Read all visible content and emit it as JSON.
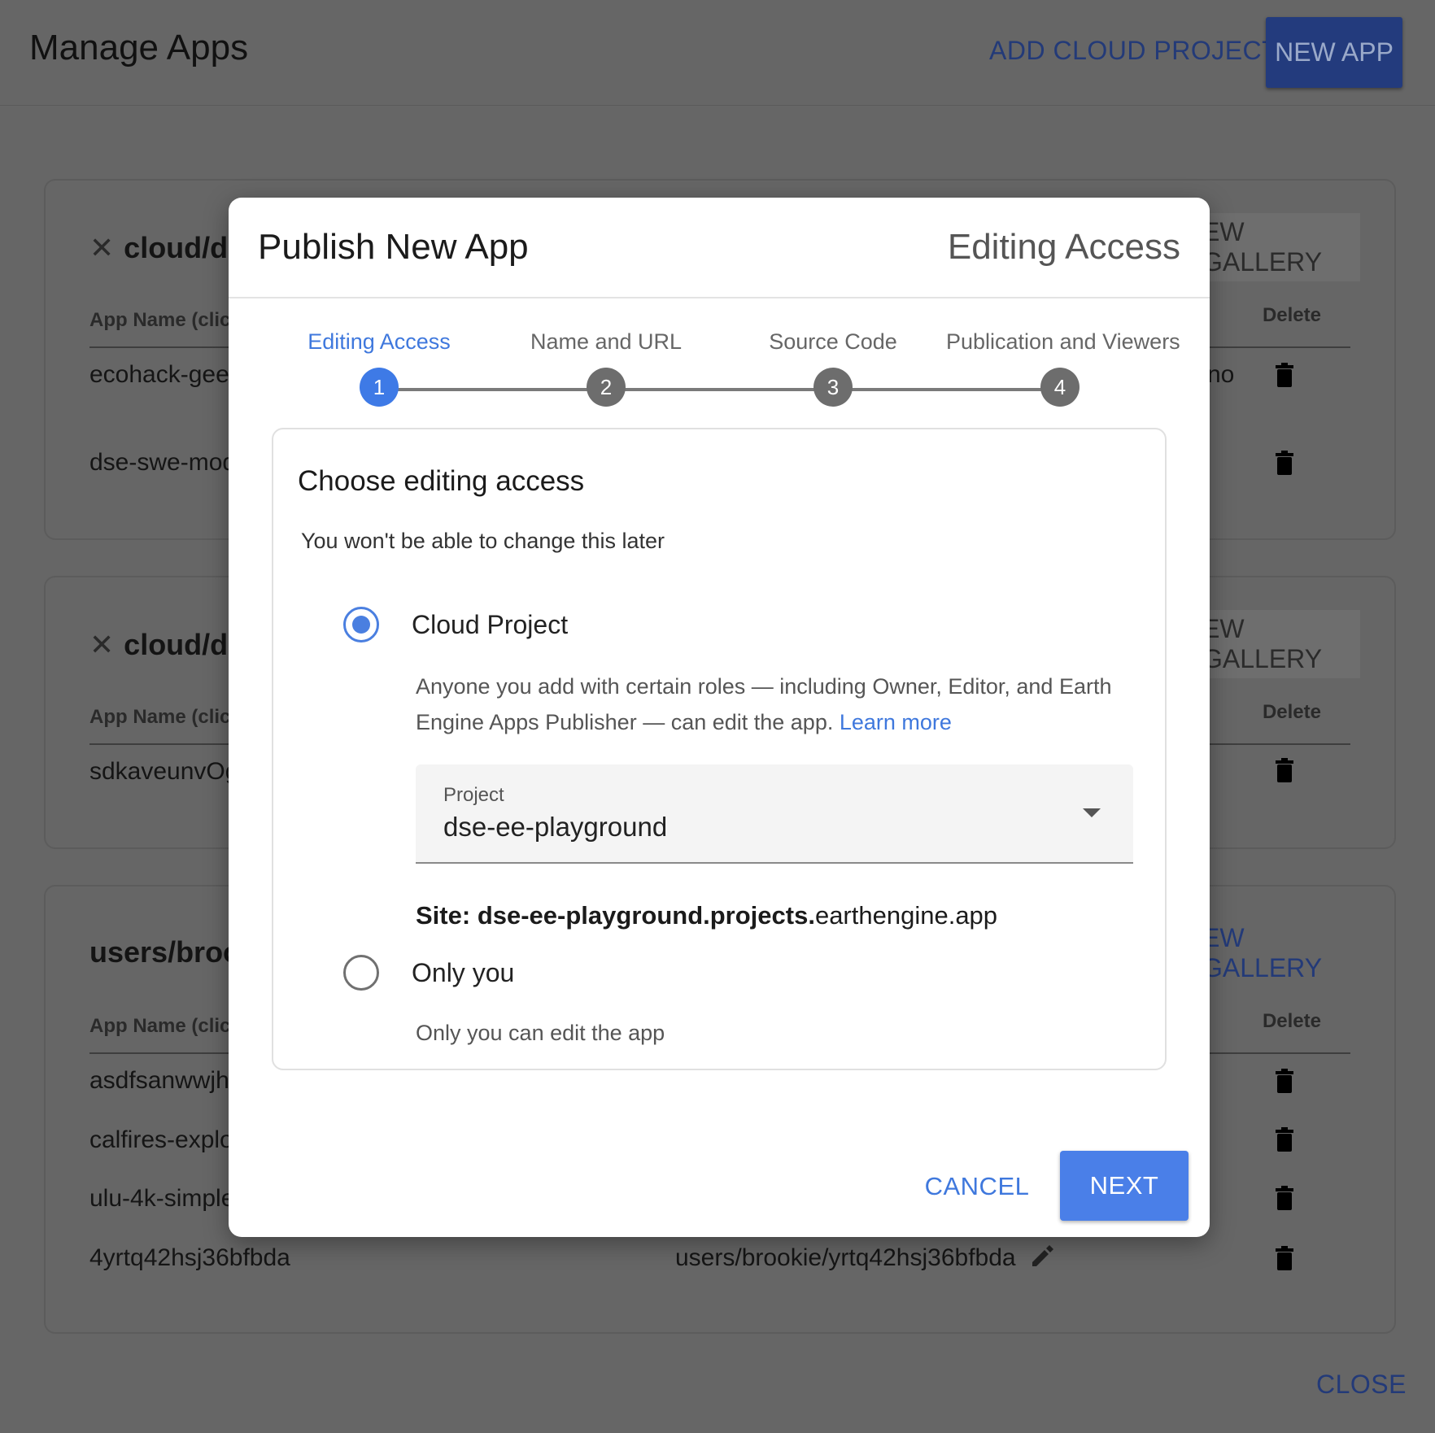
{
  "background": {
    "title": "Manage Apps",
    "add_cloud_project": "ADD CLOUD PROJECT",
    "new_app": "NEW APP",
    "close": "CLOSE",
    "delete_header": "Delete",
    "app_name_header": "App Name (clic",
    "gallery_label": "EW GALLERY",
    "cards": [
      {
        "title": "cloud/d",
        "rows": [
          "ecohack-geea",
          "dse-swe-mod"
        ],
        "extra": "no"
      },
      {
        "title": "cloud/d",
        "rows": [
          "sdkaveunvOg"
        ]
      },
      {
        "title": "users/broo",
        "rows": [
          "asdfsanwwjh",
          "calfires-explo",
          "ulu-4k-simple",
          "4yrtq42hsj36bfbda"
        ],
        "last_row_path": "users/brookie/yrtq42hsj36bfbda"
      }
    ]
  },
  "dialog": {
    "title": "Publish New App",
    "current_step_name": "Editing Access",
    "steps": [
      {
        "label": "Editing Access",
        "number": "1"
      },
      {
        "label": "Name and URL",
        "number": "2"
      },
      {
        "label": "Source Code",
        "number": "3"
      },
      {
        "label": "Publication and Viewers",
        "number": "4"
      }
    ],
    "panel": {
      "title": "Choose editing access",
      "subtitle": "You won't be able to change this later",
      "option_cloud": {
        "label": "Cloud Project",
        "desc_line1": "Anyone you add with certain roles — including Owner, Editor, and Earth",
        "desc_line2": "Engine Apps Publisher — can edit the app.",
        "learn_more": "Learn more"
      },
      "project_select": {
        "label": "Project",
        "value": "dse-ee-playground"
      },
      "site": {
        "prefix": "Site:",
        "bold_part": "dse-ee-playground.projects.",
        "rest": "earthengine.app"
      },
      "option_only_you": {
        "label": "Only you",
        "desc": "Only you can edit the app"
      }
    },
    "cancel": "CANCEL",
    "next": "NEXT"
  }
}
